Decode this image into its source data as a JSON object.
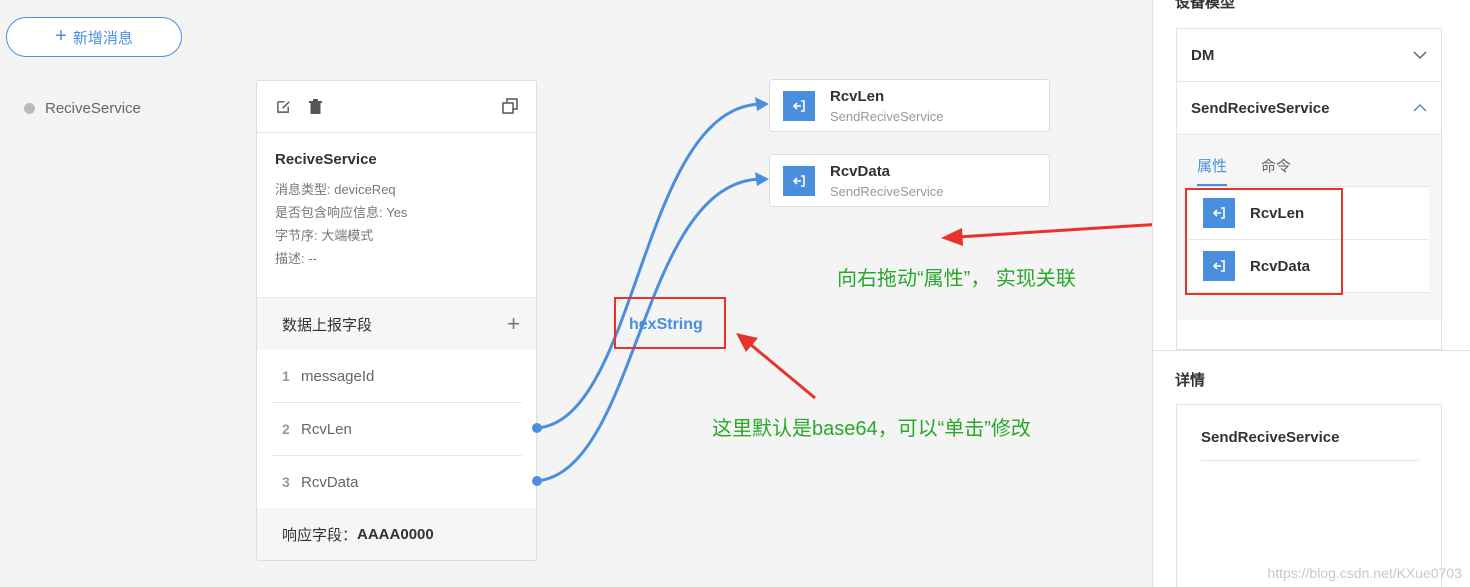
{
  "toolbar": {
    "add_message_label": "新增消息"
  },
  "left_list": {
    "items": [
      {
        "label": "ReciveService"
      }
    ]
  },
  "message_card": {
    "title": "ReciveService",
    "meta": [
      "消息类型: deviceReq",
      "是否包含响应信息: Yes",
      "字节序: 大端模式",
      "描述: --"
    ],
    "fields_header": "数据上报字段",
    "fields": [
      {
        "index": "1",
        "name": "messageId"
      },
      {
        "index": "2",
        "name": "RcvLen"
      },
      {
        "index": "3",
        "name": "RcvData"
      }
    ],
    "response_label": "响应字段：",
    "response_value": "AAAA0000"
  },
  "targets": [
    {
      "name": "RcvLen",
      "service": "SendReciveService"
    },
    {
      "name": "RcvData",
      "service": "SendReciveService"
    }
  ],
  "codec_label": "hexString",
  "right_panel": {
    "title": "设备模型",
    "accordion": [
      {
        "label": "DM",
        "expanded": false
      },
      {
        "label": "SendReciveService",
        "expanded": true
      }
    ],
    "tabs": [
      {
        "label": "属性",
        "active": true
      },
      {
        "label": "命令",
        "active": false
      }
    ],
    "attributes": [
      {
        "name": "RcvLen"
      },
      {
        "name": "RcvData"
      }
    ],
    "detail_title": "详情",
    "detail_name": "SendReciveService"
  },
  "annotations": {
    "drag_note": "向右拖动“属性”， 实现关联",
    "codec_note": "这里默认是base64，可以“单击”修改"
  },
  "colors": {
    "accent": "#4a8fde",
    "annotation_red": "#e8332a",
    "annotation_green": "#29a829"
  },
  "watermark": "https://blog.csdn.net/KXue0703"
}
